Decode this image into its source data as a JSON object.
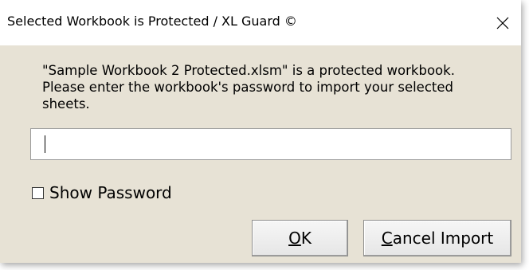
{
  "window": {
    "title": "Selected Workbook is Protected / XL Guard ©"
  },
  "message": {
    "text": "\"Sample Workbook 2 Protected.xlsm\" is a protected workbook.\nPlease enter the workbook's password to import your selected\nsheets."
  },
  "password": {
    "value": "",
    "placeholder": ""
  },
  "show_password": {
    "label": "Show Password",
    "checked": false
  },
  "buttons": {
    "ok": {
      "mnemonic": "O",
      "rest": "K"
    },
    "cancel": {
      "mnemonic": "C",
      "rest": "ancel Import"
    }
  },
  "icons": {
    "close": "close-icon"
  },
  "colors": {
    "dialog_background": "#e7e2d5",
    "titlebar_background": "#ffffff"
  }
}
